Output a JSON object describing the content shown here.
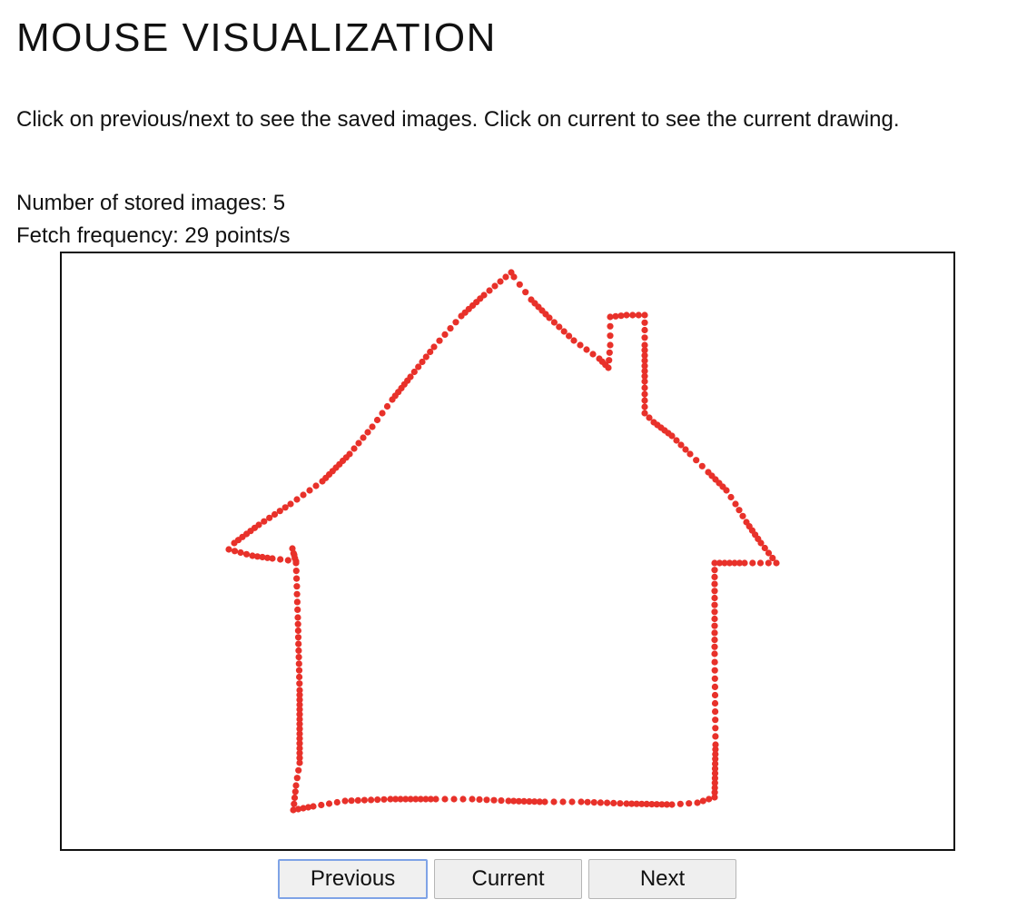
{
  "page": {
    "title": "MOUSE VISUALIZATION",
    "instructions": "Click on previous/next to see the saved images. Click on current to see the current drawing."
  },
  "stats": {
    "stored_images_text": "Number of stored images: 5",
    "fetch_frequency_text": "Fetch frequency: 29 points/s"
  },
  "drawing": {
    "stroke_color": "#e8312a",
    "subject": "house outline"
  },
  "controls": {
    "previous_label": "Previous",
    "current_label": "Current",
    "next_label": "Next"
  }
}
